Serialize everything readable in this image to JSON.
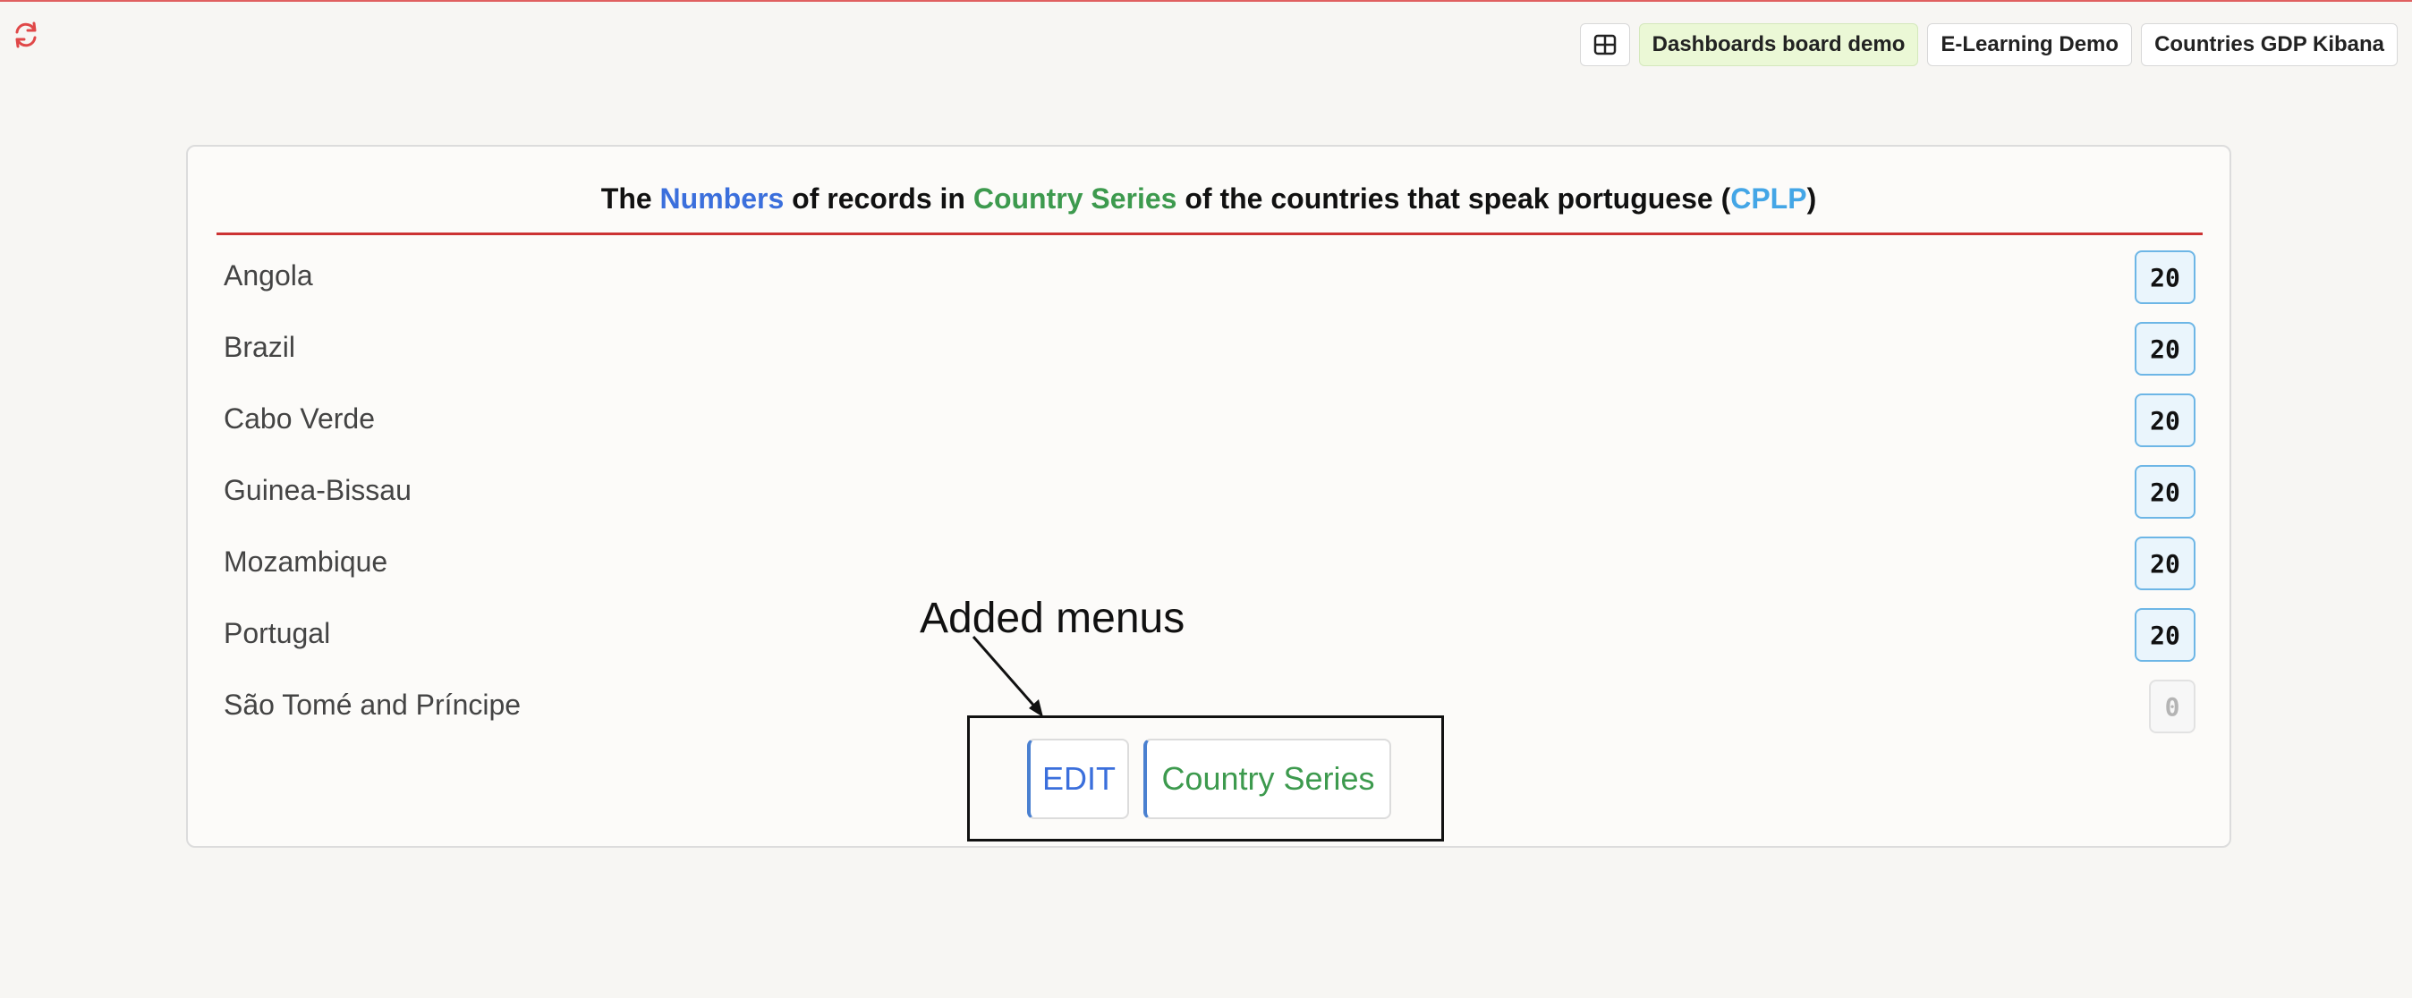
{
  "header": {
    "refresh_icon": "refresh-icon",
    "grid_icon": "grid-icon",
    "nav": [
      {
        "label": "Dashboards board demo",
        "active": true
      },
      {
        "label": "E-Learning Demo",
        "active": false
      },
      {
        "label": "Countries GDP Kibana",
        "active": false
      }
    ]
  },
  "card": {
    "title": {
      "p1": "The ",
      "numbers": "Numbers",
      "p2": " of records in ",
      "series": "Country Series",
      "p3": " of the countries that speak portuguese (",
      "cplp": "CPLP",
      "p4": ")"
    },
    "rows": [
      {
        "name": "Angola",
        "count": "20"
      },
      {
        "name": "Brazil",
        "count": "20"
      },
      {
        "name": "Cabo Verde",
        "count": "20"
      },
      {
        "name": "Guinea-Bissau",
        "count": "20"
      },
      {
        "name": "Mozambique",
        "count": "20"
      },
      {
        "name": "Portugal",
        "count": "20"
      },
      {
        "name": "São Tomé and Príncipe",
        "count": "0"
      }
    ],
    "menu": {
      "edit_label": "EDIT",
      "series_label": "Country Series"
    }
  },
  "annotation": {
    "text": "Added menus"
  },
  "colors": {
    "accent_blue": "#3b6fdc",
    "accent_green": "#3d9a4e",
    "accent_sky": "#44a6e6",
    "rule_red": "#cc3333",
    "active_nav_bg": "#ebf8d6"
  }
}
